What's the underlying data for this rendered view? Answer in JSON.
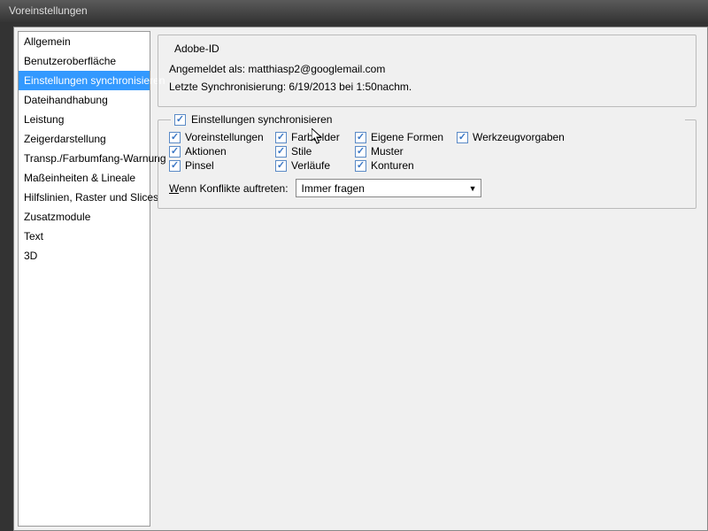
{
  "title": "Voreinstellungen",
  "sidebar": {
    "items": [
      {
        "label": "Allgemein"
      },
      {
        "label": "Benutzeroberfläche"
      },
      {
        "label": "Einstellungen synchronisieren"
      },
      {
        "label": "Dateihandhabung"
      },
      {
        "label": "Leistung"
      },
      {
        "label": "Zeigerdarstellung"
      },
      {
        "label": "Transp./Farbumfang-Warnung"
      },
      {
        "label": "Maßeinheiten & Lineale"
      },
      {
        "label": "Hilfslinien, Raster und Slices"
      },
      {
        "label": "Zusatzmodule"
      },
      {
        "label": "Text"
      },
      {
        "label": "3D"
      }
    ],
    "selected_index": 2
  },
  "adobe_id": {
    "legend": "Adobe-ID",
    "signed_in_label": "Angemeldet als:",
    "signed_in_value": "matthiasp2@googlemail.com",
    "last_sync_label": "Letzte Synchronisierung:",
    "last_sync_value": "6/19/2013 bei 1:50nachm."
  },
  "sync": {
    "legend": "Einstellungen synchronisieren",
    "checks": [
      {
        "label": "Voreinstellungen"
      },
      {
        "label": "Farbfelder"
      },
      {
        "label": "Eigene Formen"
      },
      {
        "label": "Werkzeugvorgaben"
      },
      {
        "label": "Aktionen"
      },
      {
        "label": "Stile"
      },
      {
        "label": "Muster"
      },
      {
        "label": "Pinsel"
      },
      {
        "label": "Verläufe"
      },
      {
        "label": "Konturen"
      }
    ],
    "conflict_label_pre": "W",
    "conflict_label_rest": "enn Konflikte auftreten:",
    "conflict_value": "Immer fragen"
  }
}
